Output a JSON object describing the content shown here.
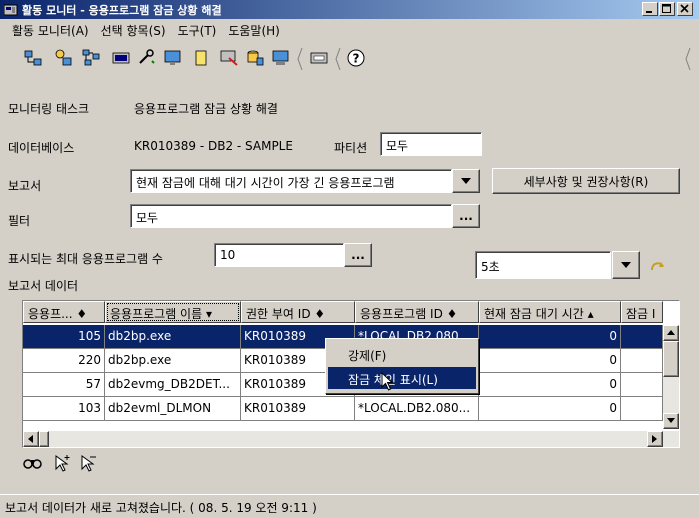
{
  "window": {
    "title": "활동 모니터 - 응용프로그램 잠금 상황 해결",
    "colors": {
      "titlebar": "#0a246a",
      "selection": "#0a246a",
      "face": "#d4d0c8"
    }
  },
  "menu": {
    "items": [
      "활동 모니터(A)",
      "선택 항목(S)",
      "도구(T)",
      "도움말(H)"
    ]
  },
  "toolbar": {
    "icons": [
      "connect-icon",
      "tree-icon",
      "network-icon",
      "terminal-icon",
      "wrench-icon",
      "monitor-settings-icon",
      "note-icon",
      "data-icon",
      "database-icon",
      "computer-icon",
      "window-icon",
      "help-icon"
    ],
    "help_label": "?"
  },
  "form": {
    "task_label": "모니터링 태스크",
    "task_value": "응용프로그램 잠금 상황 해결",
    "db_label": "데이터베이스",
    "db_value": "KR010389 - DB2 - SAMPLE",
    "partition_label": "파티션",
    "partition_value": "모두",
    "report_label": "보고서",
    "report_value": "현재 잠금에 대해 대기 시간이 가장 긴 응용프로그램",
    "details_button": "세부사항 및 권장사항(R)",
    "filter_label": "필터",
    "filter_value": "모두",
    "max_apps_label": "표시되는 최대 응용프로그램 수",
    "max_apps_value": "10",
    "ellipsis": "...",
    "refresh_value": "5초",
    "report_data_label": "보고서 데이터"
  },
  "table": {
    "columns": [
      "응용프... ♦",
      "응용프로그램 이름 ▾",
      "권한 부여 ID ♦",
      "응용프로그램 ID ♦",
      "현재 잠금 대기 시간 ▴",
      "잠금 I"
    ],
    "rows": [
      {
        "id": "105",
        "name": "db2bp.exe",
        "auth": "KR010389",
        "appid": "*LOCAL.DB2.080...",
        "wait": "0",
        "selected": true
      },
      {
        "id": "220",
        "name": "db2bp.exe",
        "auth": "KR010389",
        "appid": "",
        "wait": "0",
        "selected": false
      },
      {
        "id": "57",
        "name": "db2evmg_DB2DET...",
        "auth": "KR010389",
        "appid": "",
        "wait": "0",
        "selected": false
      },
      {
        "id": "103",
        "name": "db2evml_DLMON",
        "auth": "KR010389",
        "appid": "*LOCAL.DB2.080...",
        "wait": "0",
        "selected": false
      }
    ]
  },
  "context_menu": {
    "items": [
      "강제(F)",
      "잠금 체인 표시(L)"
    ]
  },
  "status": {
    "text": "보고서 데이터가 새로 고쳐졌습니다. ( 08. 5. 19 오전 9:11 )"
  }
}
